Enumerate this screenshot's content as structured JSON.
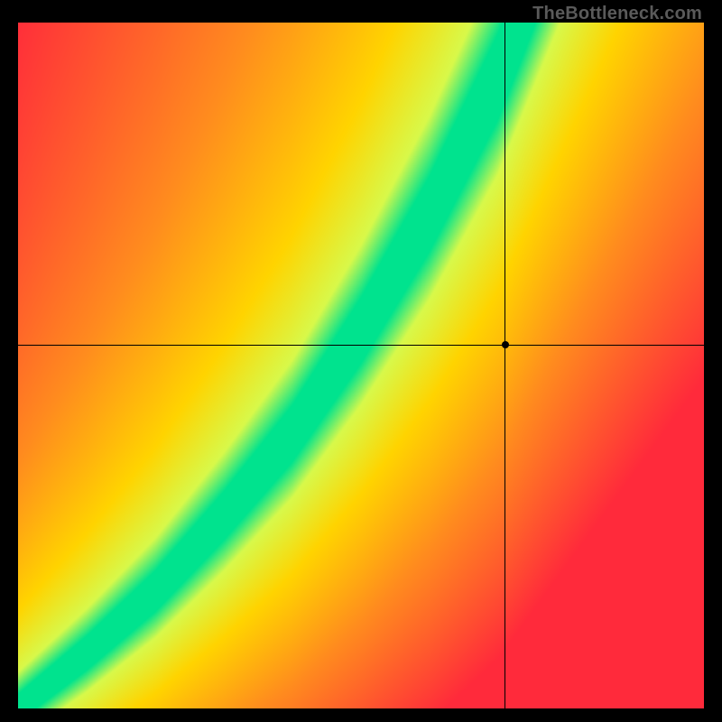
{
  "watermark": "TheBottleneck.com",
  "chart_data": {
    "type": "heatmap",
    "title": "",
    "xlabel": "",
    "ylabel": "",
    "xlim": [
      0,
      100
    ],
    "ylim": [
      0,
      100
    ],
    "grid": false,
    "legend": false,
    "crosshair": {
      "x": 71,
      "y": 53
    },
    "marker": {
      "x": 71,
      "y": 53
    },
    "colormap_note": "green = optimal, yellow = moderate, red = severe bottleneck",
    "optimal_curve_points": [
      {
        "x": 0,
        "y": 0
      },
      {
        "x": 10,
        "y": 8
      },
      {
        "x": 20,
        "y": 17
      },
      {
        "x": 30,
        "y": 28
      },
      {
        "x": 40,
        "y": 40
      },
      {
        "x": 50,
        "y": 55
      },
      {
        "x": 60,
        "y": 72
      },
      {
        "x": 70,
        "y": 92
      },
      {
        "x": 73,
        "y": 100
      }
    ],
    "band_half_width": 4,
    "color_stops": [
      {
        "dist": 0,
        "color": "#00e38e"
      },
      {
        "dist": 6,
        "color": "#d8f94a"
      },
      {
        "dist": 20,
        "color": "#ffd400"
      },
      {
        "dist": 45,
        "color": "#ff8c1e"
      },
      {
        "dist": 85,
        "color": "#ff2a3b"
      }
    ]
  }
}
